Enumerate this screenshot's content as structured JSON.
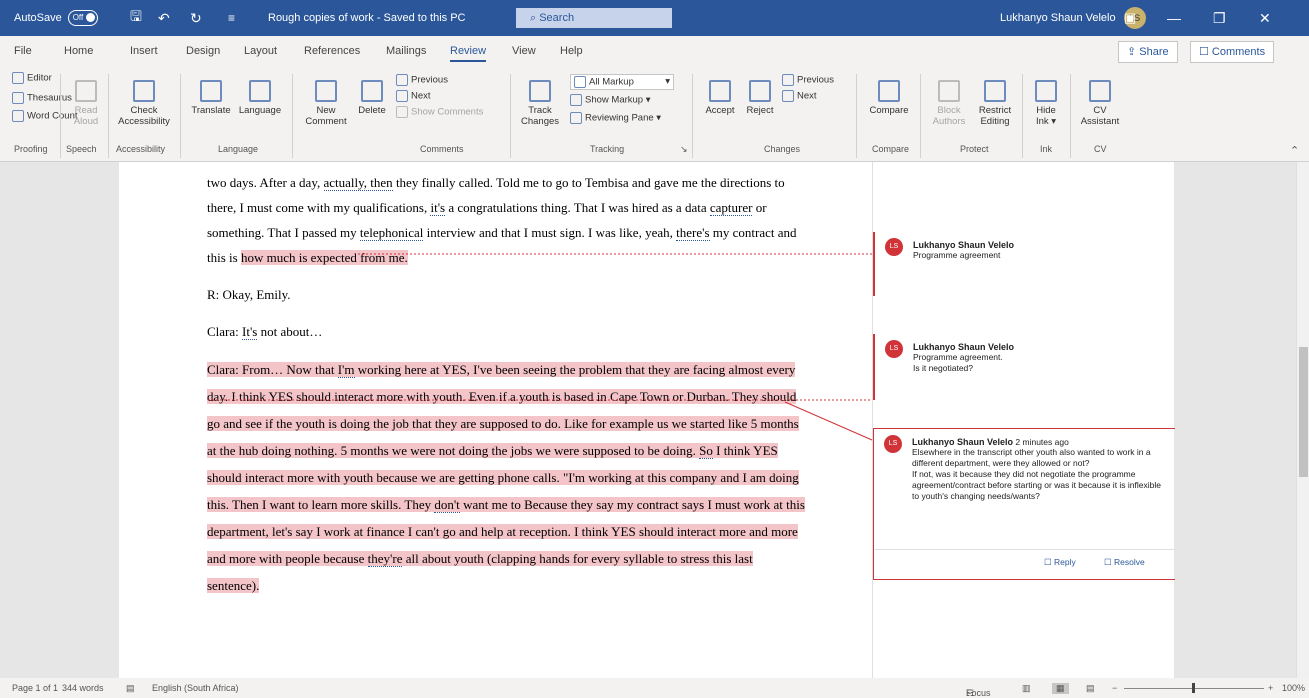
{
  "titlebar": {
    "autosave_label": "AutoSave",
    "autosave_state": "Off",
    "doc_title": "Rough copies of work - Saved to this PC",
    "search_placeholder": "Search",
    "user_name": "Lukhanyo Shaun Velelo",
    "user_initials": "LS",
    "minimize": "—",
    "restore": "❐",
    "close": "✕"
  },
  "tabs": [
    "File",
    "Home",
    "Insert",
    "Design",
    "Layout",
    "References",
    "Mailings",
    "Review",
    "View",
    "Help"
  ],
  "active_tab": "Review",
  "share_label": "Share",
  "comments_label": "Comments",
  "ribbon": {
    "editor": "Editor",
    "thesaurus": "Thesaurus",
    "word_count": "Word Count",
    "proofing": "Proofing",
    "read_aloud_1": "Read",
    "read_aloud_2": "Aloud",
    "speech": "Speech",
    "check_1": "Check",
    "check_2": "Accessibility",
    "accessibility": "Accessibility",
    "translate": "Translate",
    "language_btn": "Language",
    "language": "Language",
    "new_comment_1": "New",
    "new_comment_2": "Comment",
    "delete": "Delete",
    "previous": "Previous",
    "next": "Next",
    "show_comments": "Show Comments",
    "comments_group": "Comments",
    "track_1": "Track",
    "track_2": "Changes",
    "all_markup": "All Markup",
    "show_markup": "Show Markup",
    "reviewing_pane": "Reviewing Pane",
    "tracking": "Tracking",
    "accept": "Accept",
    "reject": "Reject",
    "prev_change": "Previous",
    "next_change": "Next",
    "changes": "Changes",
    "compare_btn": "Compare",
    "compare": "Compare",
    "block_1": "Block",
    "block_2": "Authors",
    "restrict_1": "Restrict",
    "restrict_2": "Editing",
    "protect": "Protect",
    "hide_1": "Hide",
    "hide_2": "Ink",
    "ink": "Ink",
    "cv_1": "CV",
    "cv_2": "Assistant",
    "cv": "CV"
  },
  "document": {
    "p1_a": "two days. After a day, ",
    "p1_b": "actually, then",
    "p1_c": " they finally called. Told me to go to Tembisa and gave me the directions to there, I must come with my qualifications, ",
    "p1_d": "it's",
    "p1_e": " a congratulations thing. That I was hired as a data ",
    "p1_f": "capturer",
    "p1_g": " or something. That I passed my ",
    "p1_h": "telephonical",
    "p1_i": " interview and that I must sign. I was like, yeah, ",
    "p1_j": "there's",
    "p1_k": " my contract and this is ",
    "p1_l": "how much is expected from me.",
    "p2": "R: Okay, Emily.",
    "p3_a": "Clara: ",
    "p3_b": "It's",
    "p3_c": " not about…",
    "p4_a": "Clara:  From… Now that ",
    "p4_b": "I'm",
    "p4_c": " working here at YES, I've been seeing the problem that they are facing almost every day. I think YES should interact more with youth. Even if a youth is based in Cape Town or Durban. They should go and see if the youth is doing the job that they are supposed to do. Like for example us we started like 5 months at the hub doing nothing. 5 months we were not doing the jobs we were supposed to be doing. ",
    "p4_d": "So",
    "p4_e": " I think YES should interact more with youth because we are getting phone calls. \"I'm working at this company and I am doing this. Then I want to learn more skills. They ",
    "p4_f": "don't",
    "p4_g": " want me to Because they say my contract says I must work at this department, let's say I work at finance I can't go and help at reception. I think YES should interact more and more and more with people because ",
    "p4_h": "they're",
    "p4_i": " all about youth (clapping hands for every syllable to stress this last sentence)."
  },
  "comments": [
    {
      "author": "Lukhanyo Shaun Velelo",
      "initials": "LS",
      "text": "Programme agreement",
      "time": ""
    },
    {
      "author": "Lukhanyo Shaun Velelo",
      "initials": "LS",
      "text": "Programme agreement.\nIs it negotiated?",
      "time": ""
    },
    {
      "author": "Lukhanyo Shaun Velelo",
      "initials": "LS",
      "time": "2 minutes ago",
      "text": "Elsewhere in the transcript other youth also wanted to work in a different department, were they allowed or not?\nIf not, was it because they did not negotiate the programme agreement/contract before starting or was it because it is inflexible to youth's changing needs/wants?",
      "reply": "Reply",
      "resolve": "Resolve"
    }
  ],
  "status": {
    "page": "Page 1 of 1",
    "words": "344 words",
    "language": "English (South Africa)",
    "focus": "Focus",
    "zoom": "100%"
  },
  "colors": {
    "accent": "#2b579a",
    "comment": "#d13438",
    "highlight": "#f3c4c8"
  }
}
